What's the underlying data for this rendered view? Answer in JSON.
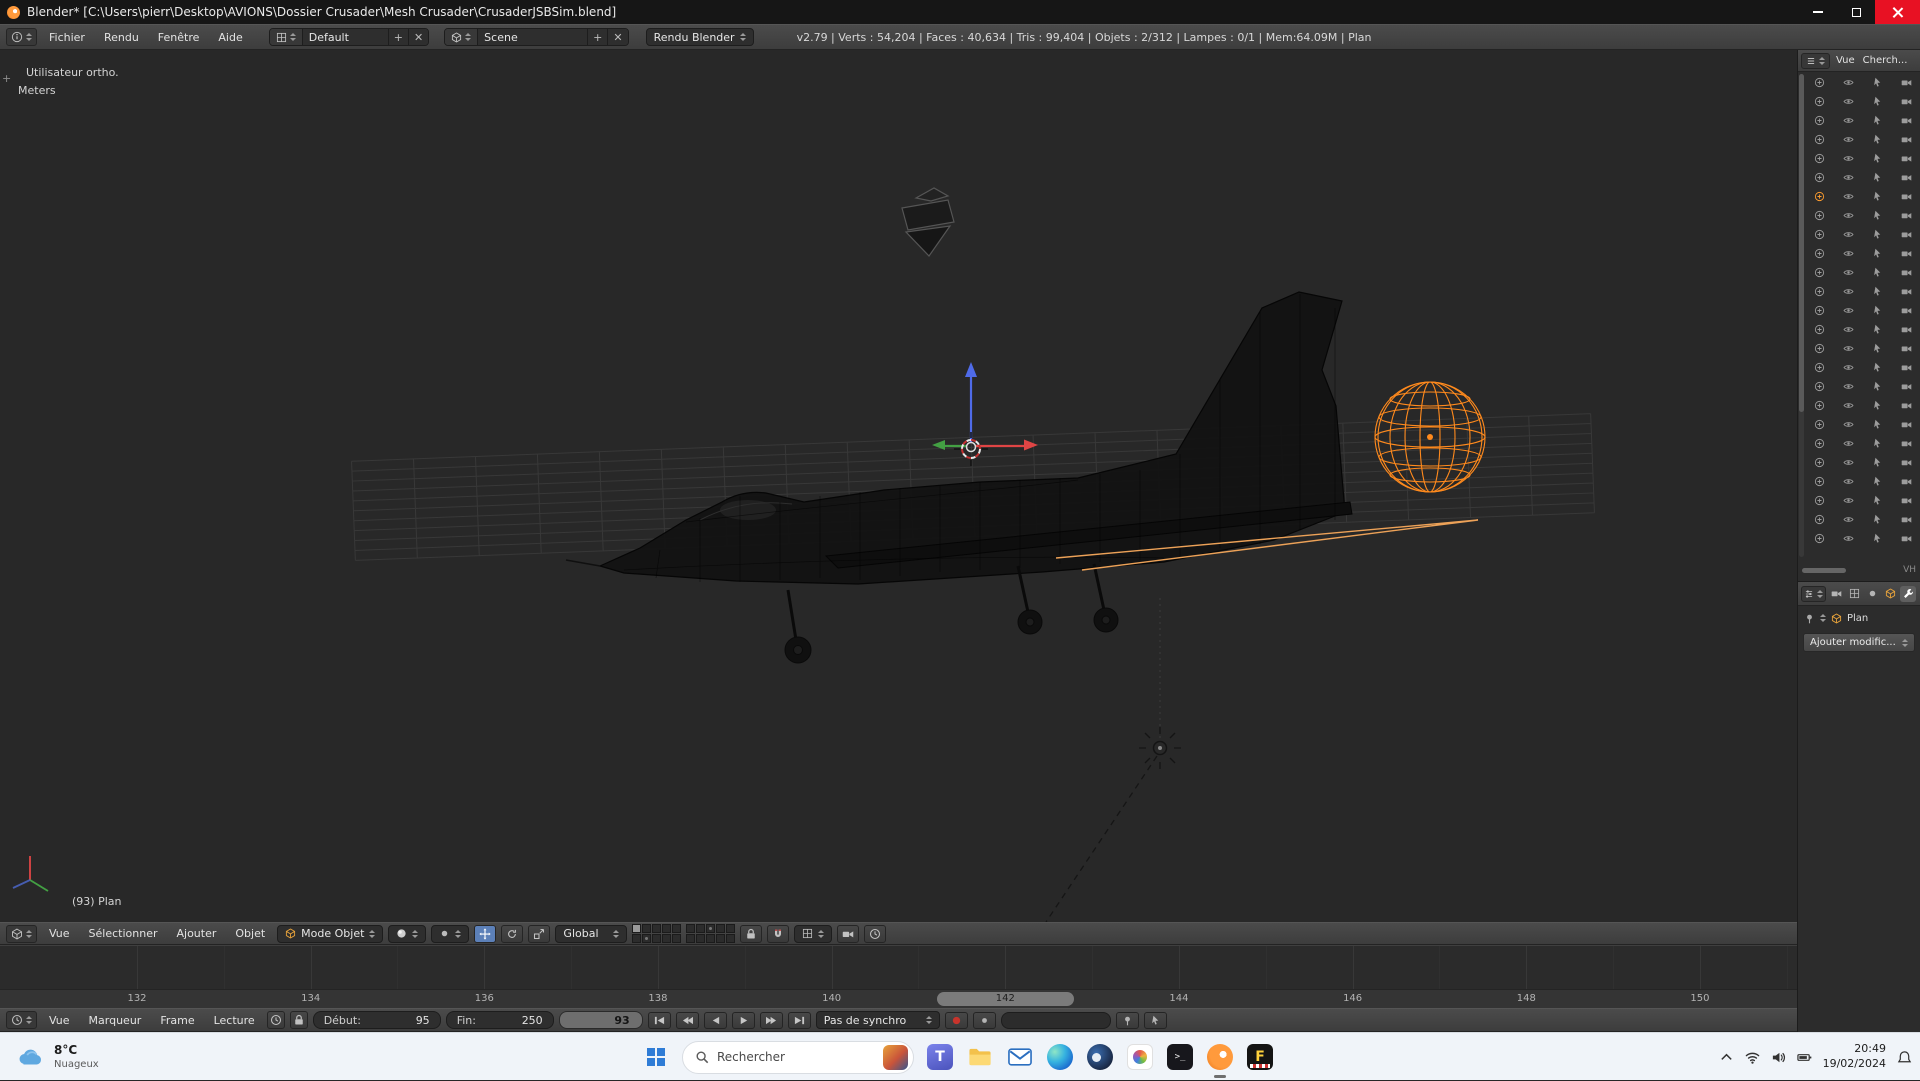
{
  "window": {
    "title": "Blender* [C:\\Users\\pierr\\Desktop\\AVIONS\\Dossier Crusader\\Mesh Crusader\\CrusaderJSBSim.blend]"
  },
  "info_header": {
    "menus": [
      "Fichier",
      "Rendu",
      "Fenêtre",
      "Aide"
    ],
    "layout_name": "Default",
    "scene_name": "Scene",
    "engine_name": "Rendu Blender",
    "stats": "v2.79 | Verts : 54,204 | Faces : 40,634 | Tris : 99,404 | Objets : 2/312 | Lampes : 0/1 | Mem:64.09M | Plan"
  },
  "viewport": {
    "view_label": "Utilisateur ortho.",
    "units_label": "Meters",
    "active_object_label": "(93) Plan",
    "region_expand_handle": "+"
  },
  "outliner": {
    "view_menu": "Vue",
    "search_label": "Cherch...",
    "row_count": 25,
    "selected_row": 6,
    "corner_label": "VH"
  },
  "properties": {
    "object_name": "Plan",
    "add_modifier_label": "Ajouter modific..."
  },
  "view3d_header": {
    "menus": [
      "Vue",
      "Sélectionner",
      "Ajouter",
      "Objet"
    ],
    "mode_label": "Mode Objet",
    "orientation_label": "Global",
    "active_layer": 0
  },
  "timeline": {
    "frame_ticks": [
      132,
      134,
      136,
      138,
      140,
      142,
      144,
      146,
      148,
      150
    ],
    "scrollbar_frame": 142
  },
  "timeline_header": {
    "menus": [
      "Vue",
      "Marqueur",
      "Frame",
      "Lecture"
    ],
    "start_label": "Début:",
    "start_value": "95",
    "end_label": "Fin:",
    "end_value": "250",
    "current_frame": "93",
    "sync_label": "Pas de synchro"
  },
  "taskbar": {
    "weather_temp": "8°C",
    "weather_desc": "Nuageux",
    "search_placeholder": "Rechercher",
    "clock_time": "20:49",
    "clock_date": "19/02/2024",
    "active_app": "blender",
    "apps": [
      {
        "name": "teams",
        "glyph": "T"
      },
      {
        "name": "explorer",
        "glyph": ""
      },
      {
        "name": "mail",
        "glyph": ""
      },
      {
        "name": "edge",
        "glyph": ""
      },
      {
        "name": "steam",
        "glyph": ""
      },
      {
        "name": "photos",
        "glyph": ""
      },
      {
        "name": "terminal",
        "glyph": ">_"
      },
      {
        "name": "blender",
        "glyph": ""
      },
      {
        "name": "flightgear",
        "glyph": "F"
      }
    ]
  },
  "colors": {
    "selection_orange": "#ff8a1d",
    "active_outline": "#eda258",
    "axis_x": "#e04545",
    "axis_y": "#43a043",
    "axis_z": "#4f6be8"
  }
}
